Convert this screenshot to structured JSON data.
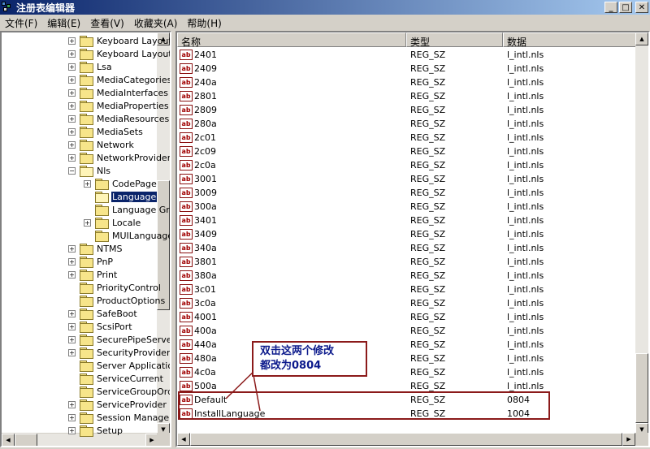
{
  "window": {
    "title": "注册表编辑器",
    "controls": {
      "minimize": "_",
      "maximize": "□",
      "close": "✕"
    }
  },
  "menu": [
    "文件(F)",
    "编辑(E)",
    "查看(V)",
    "收藏夹(A)",
    "帮助(H)"
  ],
  "tree": {
    "items": [
      {
        "label": "Keyboard Layout",
        "level": 0,
        "expander": "+"
      },
      {
        "label": "Keyboard Layouts",
        "level": 0,
        "expander": "+"
      },
      {
        "label": "Lsa",
        "level": 0,
        "expander": "+"
      },
      {
        "label": "MediaCategories",
        "level": 0,
        "expander": "+"
      },
      {
        "label": "MediaInterfaces",
        "level": 0,
        "expander": "+"
      },
      {
        "label": "MediaProperties",
        "level": 0,
        "expander": "+"
      },
      {
        "label": "MediaResources",
        "level": 0,
        "expander": "+"
      },
      {
        "label": "MediaSets",
        "level": 0,
        "expander": "+"
      },
      {
        "label": "Network",
        "level": 0,
        "expander": "+"
      },
      {
        "label": "NetworkProvider",
        "level": 0,
        "expander": "+"
      },
      {
        "label": "Nls",
        "level": 0,
        "expander": "−",
        "open": true
      },
      {
        "label": "CodePage",
        "level": 1,
        "expander": "+"
      },
      {
        "label": "Language",
        "level": 1,
        "expander": "",
        "open": true,
        "selected": true
      },
      {
        "label": "Language Groups",
        "level": 1,
        "expander": ""
      },
      {
        "label": "Locale",
        "level": 1,
        "expander": "+"
      },
      {
        "label": "MUILanguages",
        "level": 1,
        "expander": ""
      },
      {
        "label": "NTMS",
        "level": 0,
        "expander": "+"
      },
      {
        "label": "PnP",
        "level": 0,
        "expander": "+"
      },
      {
        "label": "Print",
        "level": 0,
        "expander": "+"
      },
      {
        "label": "PriorityControl",
        "level": 0,
        "expander": ""
      },
      {
        "label": "ProductOptions",
        "level": 0,
        "expander": ""
      },
      {
        "label": "SafeBoot",
        "level": 0,
        "expander": "+"
      },
      {
        "label": "ScsiPort",
        "level": 0,
        "expander": "+"
      },
      {
        "label": "SecurePipeServers",
        "level": 0,
        "expander": "+"
      },
      {
        "label": "SecurityProviders",
        "level": 0,
        "expander": "+"
      },
      {
        "label": "Server Applications",
        "level": 0,
        "expander": ""
      },
      {
        "label": "ServiceCurrent",
        "level": 0,
        "expander": ""
      },
      {
        "label": "ServiceGroupOrder",
        "level": 0,
        "expander": ""
      },
      {
        "label": "ServiceProvider",
        "level": 0,
        "expander": "+"
      },
      {
        "label": "Session Manager",
        "level": 0,
        "expander": "+"
      },
      {
        "label": "Setup",
        "level": 0,
        "expander": "+"
      }
    ]
  },
  "list": {
    "columns": [
      "名称",
      "类型",
      "数据"
    ],
    "rows": [
      {
        "name": "2401",
        "type": "REG_SZ",
        "data": "l_intl.nls"
      },
      {
        "name": "2409",
        "type": "REG_SZ",
        "data": "l_intl.nls"
      },
      {
        "name": "240a",
        "type": "REG_SZ",
        "data": "l_intl.nls"
      },
      {
        "name": "2801",
        "type": "REG_SZ",
        "data": "l_intl.nls"
      },
      {
        "name": "2809",
        "type": "REG_SZ",
        "data": "l_intl.nls"
      },
      {
        "name": "280a",
        "type": "REG_SZ",
        "data": "l_intl.nls"
      },
      {
        "name": "2c01",
        "type": "REG_SZ",
        "data": "l_intl.nls"
      },
      {
        "name": "2c09",
        "type": "REG_SZ",
        "data": "l_intl.nls"
      },
      {
        "name": "2c0a",
        "type": "REG_SZ",
        "data": "l_intl.nls"
      },
      {
        "name": "3001",
        "type": "REG_SZ",
        "data": "l_intl.nls"
      },
      {
        "name": "3009",
        "type": "REG_SZ",
        "data": "l_intl.nls"
      },
      {
        "name": "300a",
        "type": "REG_SZ",
        "data": "l_intl.nls"
      },
      {
        "name": "3401",
        "type": "REG_SZ",
        "data": "l_intl.nls"
      },
      {
        "name": "3409",
        "type": "REG_SZ",
        "data": "l_intl.nls"
      },
      {
        "name": "340a",
        "type": "REG_SZ",
        "data": "l_intl.nls"
      },
      {
        "name": "3801",
        "type": "REG_SZ",
        "data": "l_intl.nls"
      },
      {
        "name": "380a",
        "type": "REG_SZ",
        "data": "l_intl.nls"
      },
      {
        "name": "3c01",
        "type": "REG_SZ",
        "data": "l_intl.nls"
      },
      {
        "name": "3c0a",
        "type": "REG_SZ",
        "data": "l_intl.nls"
      },
      {
        "name": "4001",
        "type": "REG_SZ",
        "data": "l_intl.nls"
      },
      {
        "name": "400a",
        "type": "REG_SZ",
        "data": "l_intl.nls"
      },
      {
        "name": "440a",
        "type": "REG_SZ",
        "data": "l_intl.nls"
      },
      {
        "name": "480a",
        "type": "REG_SZ",
        "data": "l_intl.nls"
      },
      {
        "name": "4c0a",
        "type": "REG_SZ",
        "data": "l_intl.nls"
      },
      {
        "name": "500a",
        "type": "REG_SZ",
        "data": "l_intl.nls"
      },
      {
        "name": "Default",
        "type": "REG_SZ",
        "data": "0804"
      },
      {
        "name": "InstallLanguage",
        "type": "REG_SZ",
        "data": "1004"
      }
    ],
    "value_icon_text": "ab"
  },
  "annotation": {
    "line1": "双击这两个修改",
    "line2": "都改为0804",
    "color": "#8b1a1a",
    "text_color": "#0c1a8c"
  }
}
